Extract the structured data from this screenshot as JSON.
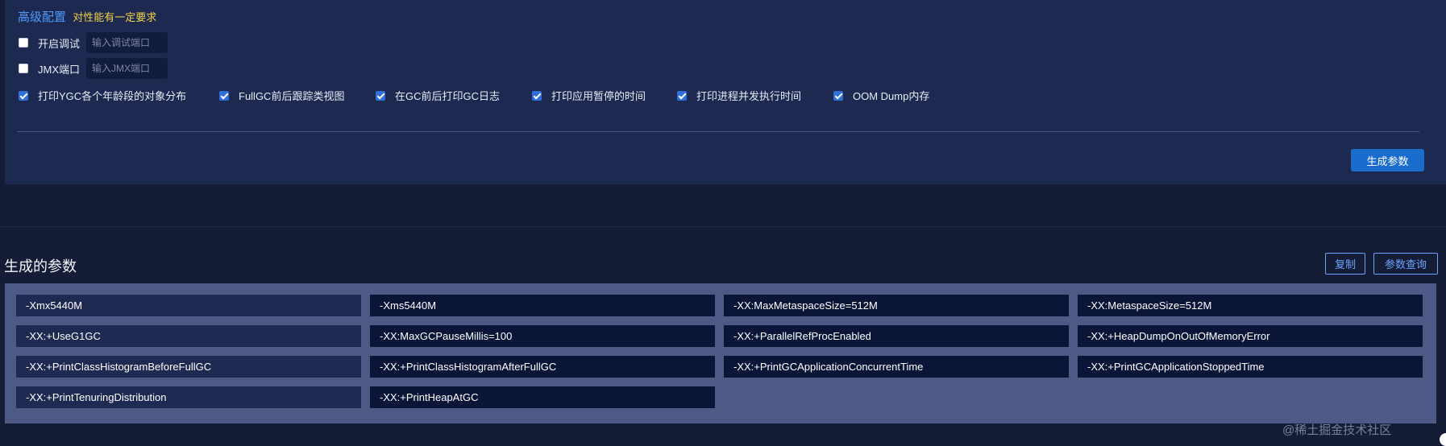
{
  "advanced": {
    "title": "高级配置",
    "note": "对性能有一定要求",
    "debug": {
      "label": "开启调试",
      "checked": false,
      "placeholder": "输入调试端口"
    },
    "jmx": {
      "label": "JMX端口",
      "checked": false,
      "placeholder": "输入JMX端口"
    },
    "options": [
      {
        "label": "打印YGC各个年龄段的对象分布",
        "checked": true
      },
      {
        "label": "FullGC前后跟踪类视图",
        "checked": true
      },
      {
        "label": "在GC前后打印GC日志",
        "checked": true
      },
      {
        "label": "打印应用暂停的时间",
        "checked": true
      },
      {
        "label": "打印进程并发执行时间",
        "checked": true
      },
      {
        "label": "OOM Dump内存",
        "checked": true
      }
    ],
    "generate_label": "生成参数"
  },
  "result": {
    "title": "生成的参数",
    "copy_label": "复制",
    "query_label": "参数查询",
    "params": [
      "-Xmx5440M",
      "-Xms5440M",
      "-XX:MaxMetaspaceSize=512M",
      "-XX:MetaspaceSize=512M",
      "-XX:+UseG1GC",
      "-XX:MaxGCPauseMillis=100",
      "-XX:+ParallelRefProcEnabled",
      "-XX:+HeapDumpOnOutOfMemoryError",
      "-XX:+PrintClassHistogramBeforeFullGC",
      "-XX:+PrintClassHistogramAfterFullGC",
      "-XX:+PrintGCApplicationConcurrentTime",
      "-XX:+PrintGCApplicationStoppedTime",
      "-XX:+PrintTenuringDistribution",
      "-XX:+PrintHeapAtGC"
    ]
  },
  "watermark": "@稀土掘金技术社区",
  "colors": {
    "accent": "#1a6dcc",
    "title_blue": "#4d9bff",
    "note_yellow": "#f0d24a",
    "cell_dark": "#0b1538",
    "cell_alt": "#1f2a52"
  }
}
